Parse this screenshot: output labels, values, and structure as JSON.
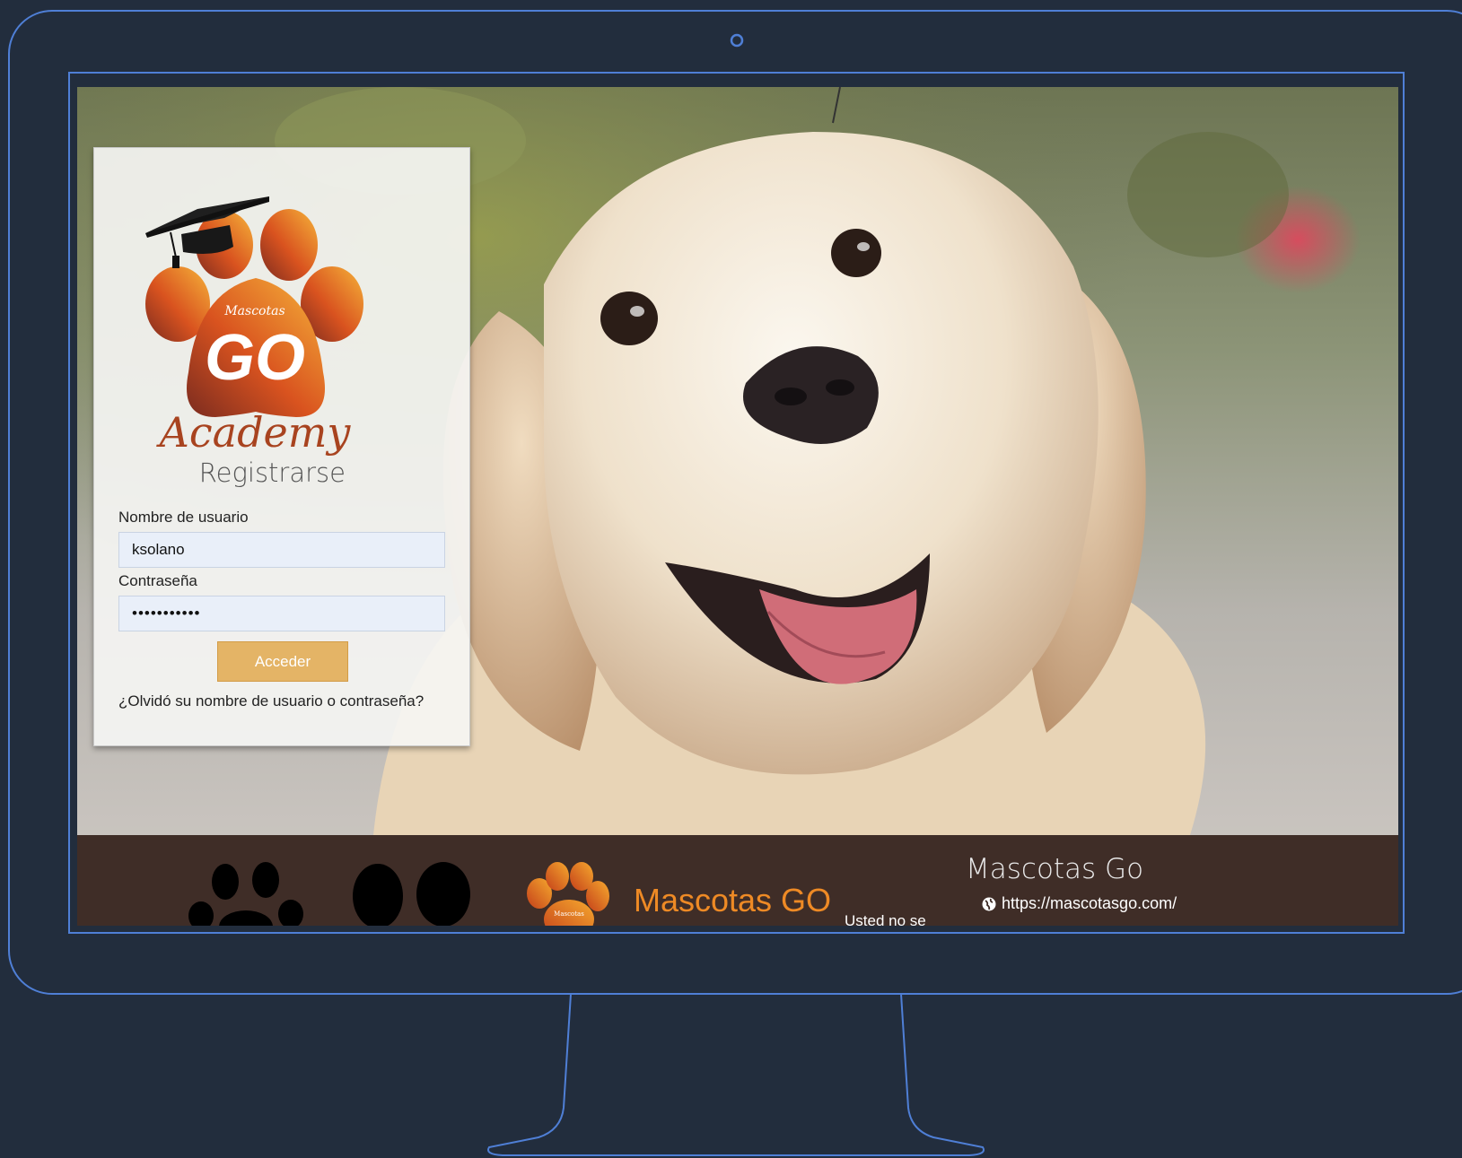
{
  "login": {
    "logo_top_text": "Mascotas",
    "logo_big_text": "GO",
    "logo_script_text": "Academy",
    "title": "Registrarse",
    "username_label": "Nombre de usuario",
    "username_value": "ksolano",
    "password_label": "Contraseña",
    "password_value": "•••••••••••",
    "submit_label": "Acceder",
    "forgot_link": "¿Olvidó su nombre de usuario o contraseña?"
  },
  "footer": {
    "site_title": "Mascotas Go",
    "site_url": "https://mascotasgo.com/",
    "brand_text": "Mascotas GO",
    "cut_text": "Usted no se",
    "mini_logo_text": "Mascotas"
  },
  "colors": {
    "background": "#222d3d",
    "outline": "#4f7fd6",
    "footer": "#3f2d27",
    "accent": "#e4b466",
    "brand_orange": "#ee8a25"
  },
  "icons": {
    "camera": "camera-dot-icon",
    "graduation_cap": "graduation-cap-icon",
    "paw": "paw-icon",
    "globe": "globe-icon"
  }
}
